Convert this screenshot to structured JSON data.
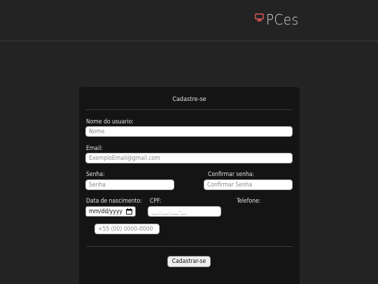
{
  "brand": {
    "logo_text": "PCes",
    "icon": "computer-monitor-icon",
    "accent_color": "#e05a5a"
  },
  "form": {
    "title": "Cadastre-se",
    "username": {
      "label": "Nome do usuario:",
      "placeholder": "Nome"
    },
    "email": {
      "label": "Email:",
      "placeholder": "ExemploEmail@gmail.com"
    },
    "password": {
      "label": "Senha:",
      "placeholder": "Senha"
    },
    "confirm_password": {
      "label": "Confirmar senha:",
      "placeholder": "Confirmar Senha"
    },
    "birthdate": {
      "label": "Data de nascimento:",
      "value": "mm/dd/yyyy",
      "icon": "calendar-icon"
    },
    "cpf": {
      "label": "CPF:",
      "placeholder": "___.___.___-__"
    },
    "phone": {
      "label": "Telefone:",
      "placeholder": "+55 (00) 0000-0000"
    },
    "submit_label": "Cadastrar-se"
  }
}
